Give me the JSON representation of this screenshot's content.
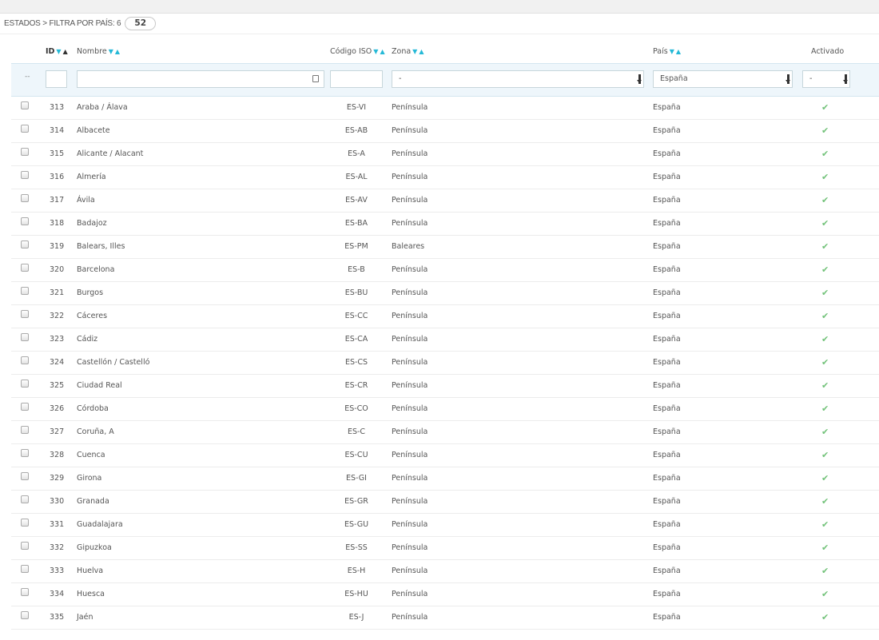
{
  "panel": {
    "title": "ESTADOS > FILTRA POR PAÍS: 6",
    "count": "52"
  },
  "columns": {
    "id": "ID",
    "nombre": "Nombre",
    "iso": "Código ISO",
    "zona": "Zona",
    "pais": "País",
    "activado": "Activado"
  },
  "filters": {
    "bulk": "--",
    "zona": "-",
    "pais": "España",
    "activado": "-"
  },
  "rows": [
    {
      "id": "313",
      "nombre": "Araba / Álava",
      "iso": "ES-VI",
      "zona": "Península",
      "pais": "España"
    },
    {
      "id": "314",
      "nombre": "Albacete",
      "iso": "ES-AB",
      "zona": "Península",
      "pais": "España"
    },
    {
      "id": "315",
      "nombre": "Alicante / Alacant",
      "iso": "ES-A",
      "zona": "Península",
      "pais": "España"
    },
    {
      "id": "316",
      "nombre": "Almería",
      "iso": "ES-AL",
      "zona": "Península",
      "pais": "España"
    },
    {
      "id": "317",
      "nombre": "Ávila",
      "iso": "ES-AV",
      "zona": "Península",
      "pais": "España"
    },
    {
      "id": "318",
      "nombre": "Badajoz",
      "iso": "ES-BA",
      "zona": "Península",
      "pais": "España"
    },
    {
      "id": "319",
      "nombre": "Balears, Illes",
      "iso": "ES-PM",
      "zona": "Baleares",
      "pais": "España"
    },
    {
      "id": "320",
      "nombre": "Barcelona",
      "iso": "ES-B",
      "zona": "Península",
      "pais": "España"
    },
    {
      "id": "321",
      "nombre": "Burgos",
      "iso": "ES-BU",
      "zona": "Península",
      "pais": "España"
    },
    {
      "id": "322",
      "nombre": "Cáceres",
      "iso": "ES-CC",
      "zona": "Península",
      "pais": "España"
    },
    {
      "id": "323",
      "nombre": "Cádiz",
      "iso": "ES-CA",
      "zona": "Península",
      "pais": "España"
    },
    {
      "id": "324",
      "nombre": "Castellón / Castelló",
      "iso": "ES-CS",
      "zona": "Península",
      "pais": "España"
    },
    {
      "id": "325",
      "nombre": "Ciudad Real",
      "iso": "ES-CR",
      "zona": "Península",
      "pais": "España"
    },
    {
      "id": "326",
      "nombre": "Córdoba",
      "iso": "ES-CO",
      "zona": "Península",
      "pais": "España"
    },
    {
      "id": "327",
      "nombre": "Coruña, A",
      "iso": "ES-C",
      "zona": "Península",
      "pais": "España"
    },
    {
      "id": "328",
      "nombre": "Cuenca",
      "iso": "ES-CU",
      "zona": "Península",
      "pais": "España"
    },
    {
      "id": "329",
      "nombre": "Girona",
      "iso": "ES-GI",
      "zona": "Península",
      "pais": "España"
    },
    {
      "id": "330",
      "nombre": "Granada",
      "iso": "ES-GR",
      "zona": "Península",
      "pais": "España"
    },
    {
      "id": "331",
      "nombre": "Guadalajara",
      "iso": "ES-GU",
      "zona": "Península",
      "pais": "España"
    },
    {
      "id": "332",
      "nombre": "Gipuzkoa",
      "iso": "ES-SS",
      "zona": "Península",
      "pais": "España"
    },
    {
      "id": "333",
      "nombre": "Huelva",
      "iso": "ES-H",
      "zona": "Península",
      "pais": "España"
    },
    {
      "id": "334",
      "nombre": "Huesca",
      "iso": "ES-HU",
      "zona": "Península",
      "pais": "España"
    },
    {
      "id": "335",
      "nombre": "Jaén",
      "iso": "ES-J",
      "zona": "Península",
      "pais": "España"
    }
  ]
}
